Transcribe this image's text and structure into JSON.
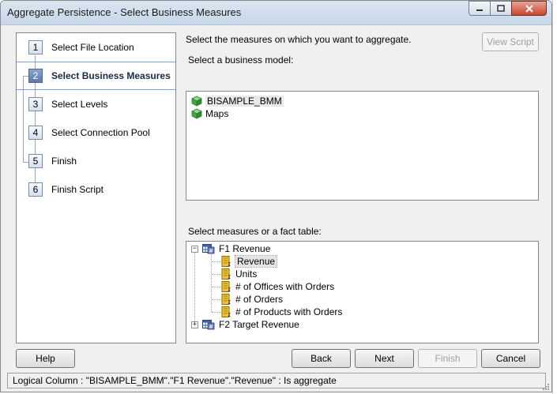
{
  "window": {
    "title": "Aggregate Persistence - Select Business Measures"
  },
  "steps": [
    {
      "num": "1",
      "label": "Select File Location"
    },
    {
      "num": "2",
      "label": "Select Business Measures"
    },
    {
      "num": "3",
      "label": "Select Levels"
    },
    {
      "num": "4",
      "label": "Select Connection Pool"
    },
    {
      "num": "5",
      "label": "Finish"
    },
    {
      "num": "6",
      "label": "Finish Script"
    }
  ],
  "active_step": "2",
  "main": {
    "instruction": "Select the measures on which you want to aggregate.",
    "view_script_label": "View Script",
    "business_model_label": "Select a business model:",
    "business_models": [
      "BISAMPLE_BMM",
      "Maps"
    ],
    "measures_label": "Select measures or a fact table:",
    "tree": {
      "f1": "F1 Revenue",
      "f1_children": [
        "Revenue",
        "Units",
        "# of Offices with Orders",
        "# of Orders",
        "# of Products with Orders"
      ],
      "f2": "F2 Target Revenue"
    }
  },
  "buttons": {
    "help": "Help",
    "back": "Back",
    "next": "Next",
    "finish": "Finish",
    "cancel": "Cancel"
  },
  "status": "Logical Column : \"BISAMPLE_BMM\".\"F1 Revenue\".\"Revenue\" : Is aggregate",
  "icons": {
    "business_model": "cube-icon",
    "fact_table": "table-icon",
    "measure": "measure-column-icon"
  }
}
